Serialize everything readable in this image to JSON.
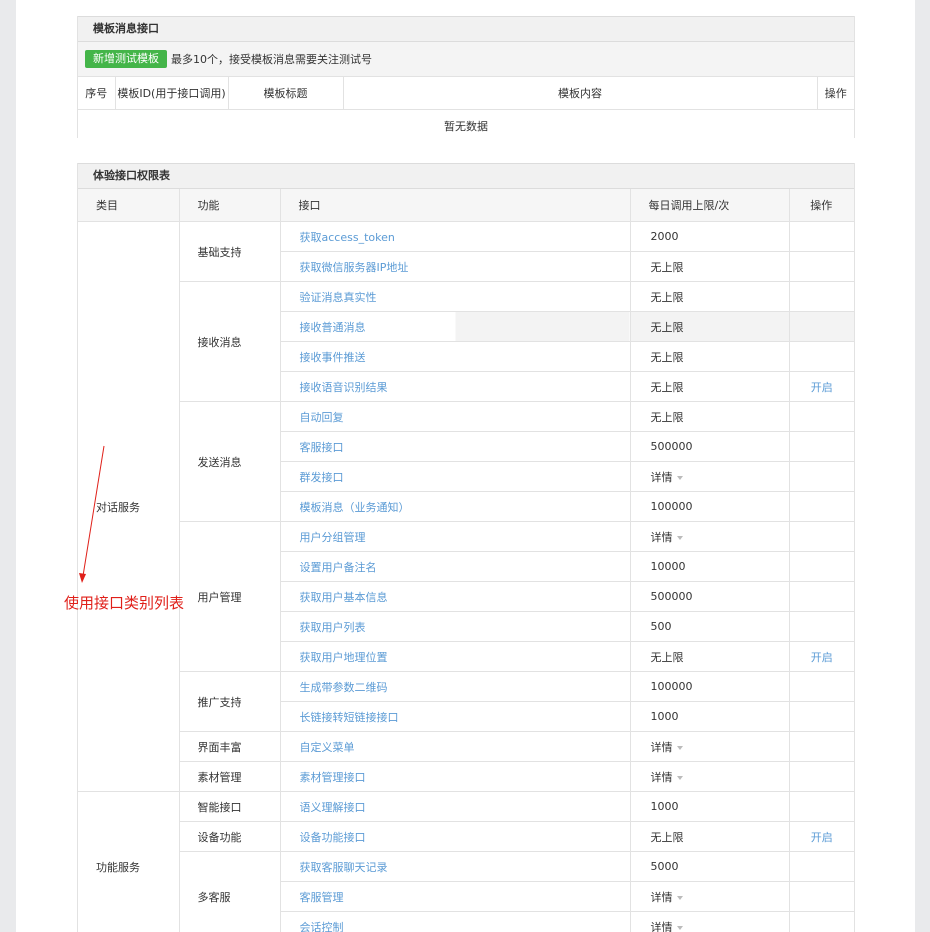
{
  "template_section": {
    "title": "模板消息接口",
    "add_button": "新增测试模板",
    "notice": "最多10个，接受模板消息需要关注测试号",
    "columns": [
      "序号",
      "模板ID(用于接口调用)",
      "模板标题",
      "模板内容",
      "操作"
    ],
    "empty_text": "暂无数据"
  },
  "permission_section": {
    "title": "体验接口权限表",
    "columns": [
      "类目",
      "功能",
      "接口",
      "每日调用上限/次",
      "操作"
    ]
  },
  "rows": [
    {
      "api": "获取access_token",
      "limit": "2000",
      "op": ""
    },
    {
      "api": "获取微信服务器IP地址",
      "limit": "无上限",
      "op": ""
    },
    {
      "api": "验证消息真实性",
      "limit": "无上限",
      "op": ""
    },
    {
      "api": "接收普通消息",
      "limit": "无上限",
      "op": ""
    },
    {
      "api": "接收事件推送",
      "limit": "无上限",
      "op": ""
    },
    {
      "api": "接收语音识别结果",
      "limit": "无上限",
      "op": "开启"
    },
    {
      "api": "自动回复",
      "limit": "无上限",
      "op": ""
    },
    {
      "api": "客服接口",
      "limit": "500000",
      "op": ""
    },
    {
      "api": "群发接口",
      "limit": "详情",
      "op": ""
    },
    {
      "api": "模板消息（业务通知）",
      "limit": "100000",
      "op": ""
    },
    {
      "api": "用户分组管理",
      "limit": "详情",
      "op": ""
    },
    {
      "api": "设置用户备注名",
      "limit": "10000",
      "op": ""
    },
    {
      "api": "获取用户基本信息",
      "limit": "500000",
      "op": ""
    },
    {
      "api": "获取用户列表",
      "limit": "500",
      "op": ""
    },
    {
      "api": "获取用户地理位置",
      "limit": "无上限",
      "op": "开启"
    },
    {
      "api": "生成带参数二维码",
      "limit": "100000",
      "op": ""
    },
    {
      "api": "长链接转短链接接口",
      "limit": "1000",
      "op": ""
    },
    {
      "api": "自定义菜单",
      "limit": "详情",
      "op": ""
    },
    {
      "api": "素材管理接口",
      "limit": "详情",
      "op": ""
    },
    {
      "api": "语义理解接口",
      "limit": "1000",
      "op": ""
    },
    {
      "api": "设备功能接口",
      "limit": "无上限",
      "op": "开启"
    },
    {
      "api": "获取客服聊天记录",
      "limit": "5000",
      "op": ""
    },
    {
      "api": "客服管理",
      "limit": "详情",
      "op": ""
    },
    {
      "api": "会话控制",
      "limit": "详情",
      "op": ""
    }
  ],
  "categories": {
    "dialog": "对话服务",
    "function": "功能服务"
  },
  "functions": {
    "basic": "基础支持",
    "receive": "接收消息",
    "send": "发送消息",
    "user": "用户管理",
    "promo": "推广支持",
    "ui": "界面丰富",
    "material": "素材管理",
    "smart": "智能接口",
    "device": "设备功能",
    "multi_cs": "多客服"
  },
  "annotation": {
    "text": "使用接口类别列表",
    "color": "#e0201a"
  },
  "colors": {
    "link": "#5b9bd5",
    "button_green": "#44b549",
    "header_bg": "#f1f1f1"
  }
}
